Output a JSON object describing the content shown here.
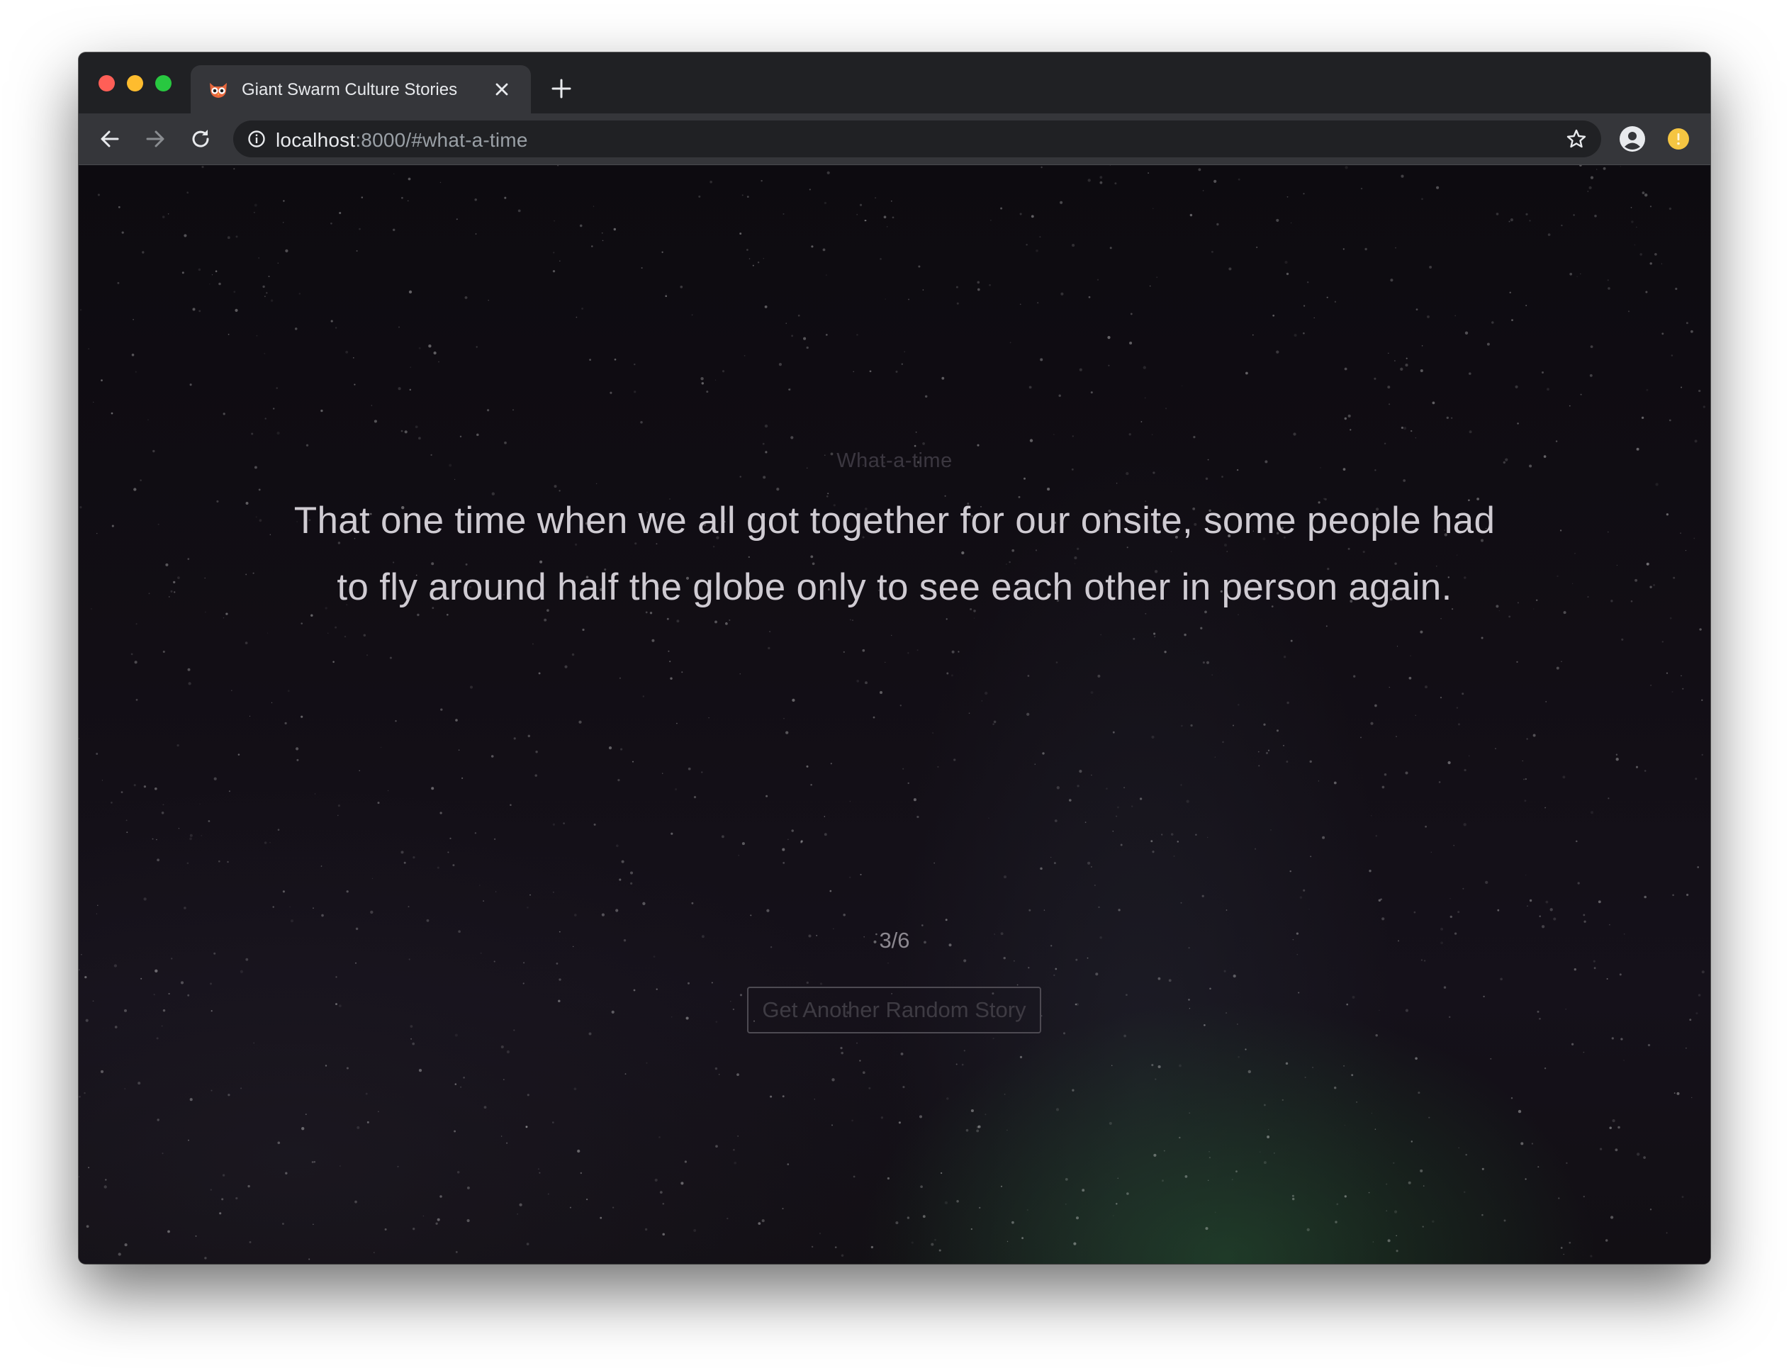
{
  "browser": {
    "tab": {
      "title": "Giant Swarm Culture Stories",
      "favicon": "owl-icon"
    },
    "url": {
      "host": "localhost",
      "rest": ":8000/#what-a-time"
    },
    "icons": {
      "back": "arrow-left-icon",
      "forward": "arrow-right-icon",
      "reload": "reload-icon",
      "info": "info-icon",
      "bookmark": "star-icon",
      "profile": "account-circle-icon",
      "extension": "extension-icon",
      "new_tab": "plus-icon",
      "close_tab": "close-icon"
    },
    "colors": {
      "traffic_red": "#ff5f57",
      "traffic_yellow": "#febc2e",
      "traffic_green": "#28c840"
    }
  },
  "page": {
    "story_slug": "What-a-time",
    "story_text": "That one time when we all got together for our onsite, some people had to fly around half the globe only to see each other in person again.",
    "counter": "3/6",
    "random_button_label": "Get Another Random Story"
  }
}
